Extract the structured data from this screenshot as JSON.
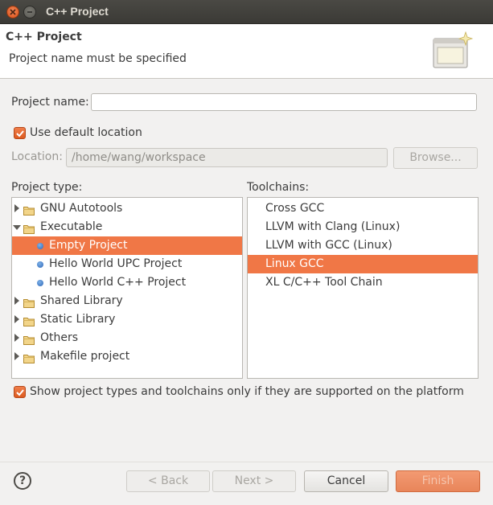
{
  "window": {
    "title": "C++ Project"
  },
  "header": {
    "title": "C++ Project",
    "message": "Project name must be specified",
    "banner_icon": "wizard-banner-icon"
  },
  "project_name": {
    "label": "Project name:",
    "value": ""
  },
  "use_default_location": {
    "label": "Use default location",
    "checked": true
  },
  "location": {
    "label": "Location:",
    "value": "/home/wang/workspace",
    "browse_label": "Browse..."
  },
  "project_type": {
    "label": "Project type:",
    "items": [
      {
        "label": "GNU Autotools",
        "kind": "folder",
        "state": "collapsed",
        "level": 0
      },
      {
        "label": "Executable",
        "kind": "folder",
        "state": "expanded",
        "level": 0
      },
      {
        "label": "Empty Project",
        "kind": "item",
        "level": 1,
        "selected": true
      },
      {
        "label": "Hello World UPC Project",
        "kind": "item",
        "level": 1
      },
      {
        "label": "Hello World C++ Project",
        "kind": "item",
        "level": 1
      },
      {
        "label": "Shared Library",
        "kind": "folder",
        "state": "collapsed",
        "level": 0
      },
      {
        "label": "Static Library",
        "kind": "folder",
        "state": "collapsed",
        "level": 0
      },
      {
        "label": "Others",
        "kind": "folder",
        "state": "collapsed",
        "level": 0
      },
      {
        "label": "Makefile project",
        "kind": "folder",
        "state": "collapsed",
        "level": 0
      }
    ]
  },
  "toolchains": {
    "label": "Toolchains:",
    "items": [
      {
        "label": "Cross GCC"
      },
      {
        "label": "LLVM with Clang (Linux)"
      },
      {
        "label": "LLVM with GCC (Linux)"
      },
      {
        "label": "Linux GCC",
        "selected": true
      },
      {
        "label": "XL C/C++ Tool Chain"
      }
    ]
  },
  "show_supported": {
    "label": "Show project types and toolchains only if they are supported on the platform",
    "checked": true
  },
  "buttons": {
    "help": "?",
    "back": "< Back",
    "next": "Next >",
    "cancel": "Cancel",
    "finish": "Finish"
  },
  "colors": {
    "accent": "#f07746",
    "titlebar": "#3c3b37",
    "close": "#e05f24"
  }
}
